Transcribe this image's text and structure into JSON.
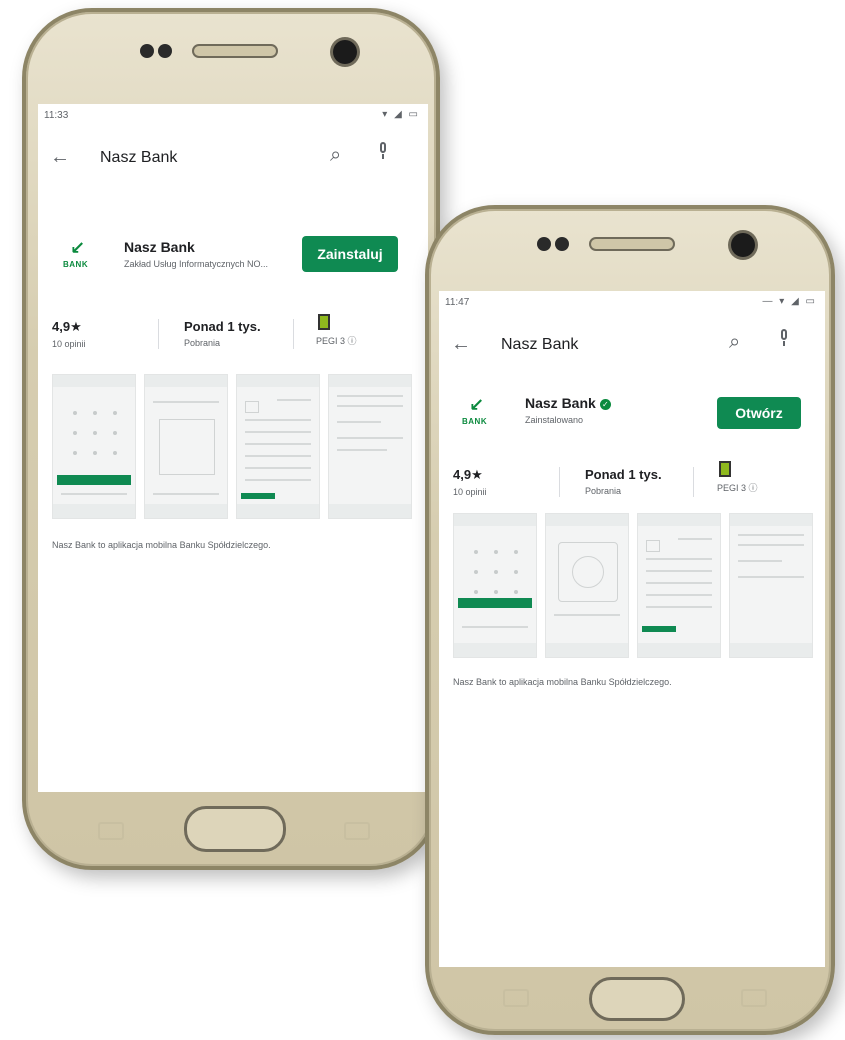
{
  "colors": {
    "accent": "#0f8a52",
    "bezel": "#d6cdb0"
  },
  "left_phone": {
    "status": {
      "time": "11:33",
      "icons": "▾ ◢ ▭"
    },
    "search": {
      "back_icon": "←",
      "query": "Nasz Bank",
      "search_icon": "⌕"
    },
    "app": {
      "name": "Nasz Bank",
      "subtitle": "Zakład Usług Informatycznych NO...",
      "logo_text": "BANK",
      "button": "Zainstaluj"
    },
    "stats": [
      {
        "value": "4,9★",
        "label": "10 opinii"
      },
      {
        "value": "Ponad 1 tys.",
        "label": "Pobrania"
      },
      {
        "value": "",
        "label": "PEGI 3 ⓘ"
      }
    ],
    "description": "Nasz Bank to aplikacja mobilna Banku Spółdzielczego."
  },
  "right_phone": {
    "status": {
      "time": "11:47",
      "icons": "— ▾ ◢ ▭"
    },
    "search": {
      "back_icon": "←",
      "query": "Nasz Bank",
      "search_icon": "⌕"
    },
    "app": {
      "name": "Nasz Bank",
      "subtitle": "Zainstalowano",
      "logo_text": "BANK",
      "button": "Otwórz"
    },
    "stats": [
      {
        "value": "4,9★",
        "label": "10 opinii"
      },
      {
        "value": "Ponad 1 tys.",
        "label": "Pobrania"
      },
      {
        "value": "",
        "label": "PEGI 3 ⓘ"
      }
    ],
    "description": "Nasz Bank to aplikacja mobilna Banku Spółdzielczego."
  }
}
